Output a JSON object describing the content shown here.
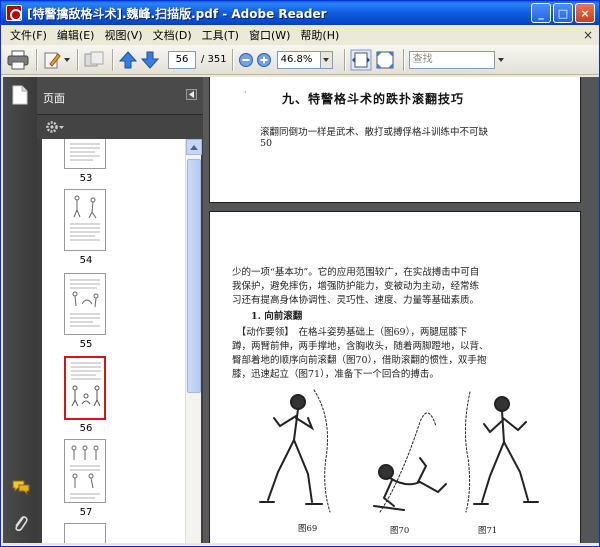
{
  "window": {
    "title": "[特警擒敌格斗术].魏峰.扫描版.pdf - Adobe Reader",
    "controls": [
      "_",
      "□",
      "×"
    ]
  },
  "menu": {
    "items": [
      "文件(F)",
      "编辑(E)",
      "视图(V)",
      "文档(D)",
      "工具(T)",
      "窗口(W)",
      "帮助(H)"
    ],
    "close": "×"
  },
  "toolbar": {
    "page_current": "56",
    "page_total": "/ 351",
    "zoom": "46.8%",
    "search_placeholder": "查找"
  },
  "panel": {
    "title": "页面",
    "thumbnails": [
      {
        "label": "53",
        "selected": false
      },
      {
        "label": "54",
        "selected": false
      },
      {
        "label": "55",
        "selected": false
      },
      {
        "label": "56",
        "selected": true
      },
      {
        "label": "57",
        "selected": false
      }
    ]
  },
  "document": {
    "page1": {
      "mark": "·",
      "heading": "九、特警格斗术的跌扑滚翻技巧",
      "line1": "滚翻同倒功一样是武术、散打或搏俘格斗训练中不可缺",
      "page_number": "50"
    },
    "page2": {
      "lines": [
        "少的一项“基本功”。它的应用范围较广，在实战搏击中可自",
        "我保护，避免摔伤，增强防护能力，变被动为主动，经常练",
        "习还有提高身体协调性、灵巧性、速度、力量等基础素质。",
        "　　1. 向前滚翻",
        "　【动作要领】　在格斗姿势基础上（图69），两腿屈膝下",
        "蹲，两臂前伸，两手撑地，含胸收头，随着两脚蹬地，以背、",
        "臀部着地的顺序向前滚翻（图70），借助滚翻的惯性，双手抱",
        "膝，迅速起立（图71），准备下一个回合的搏击。"
      ],
      "captions": [
        "图69",
        "图70",
        "图71"
      ]
    }
  },
  "colors": {
    "titlebar": "#0a5fd8",
    "selection": "#d4141d",
    "panel_bg": "#3e3e3e",
    "doc_bg": "#525659"
  }
}
